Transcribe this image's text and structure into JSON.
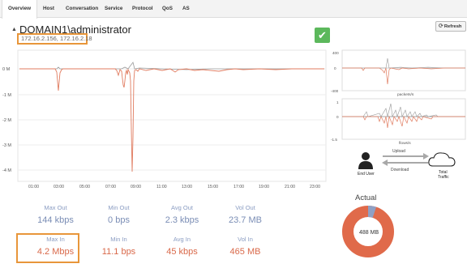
{
  "tabs": [
    {
      "label": "Overview",
      "active": true
    },
    {
      "label": "Host"
    },
    {
      "label": "Conversation"
    },
    {
      "label": "Service"
    },
    {
      "label": "Protocol"
    },
    {
      "label": "QoS"
    },
    {
      "label": "AS"
    }
  ],
  "refresh_label": "Refresh",
  "header": {
    "title": "DOMAIN1\\administrator",
    "ips": "172.16.2.156, 172.16.2.18"
  },
  "main_chart": {
    "y_ticks": [
      "0 M",
      "-1 M",
      "-2 M",
      "-3 M",
      "-4 M"
    ],
    "x_ticks": [
      "01:00",
      "03:00",
      "05:00",
      "07:00",
      "09:00",
      "11:00",
      "13:00",
      "15:00",
      "17:00",
      "19:00",
      "21:00",
      "23:00"
    ]
  },
  "chart_data": [
    {
      "type": "line",
      "x_labels": [
        "01:00",
        "03:00",
        "05:00",
        "07:00",
        "09:00",
        "11:00",
        "13:00",
        "15:00",
        "17:00",
        "19:00",
        "21:00",
        "23:00"
      ],
      "y_ticks": [
        "0 M",
        "-1 M",
        "-2 M",
        "-3 M",
        "-4 M"
      ],
      "series": [
        {
          "color": "#e07b5f",
          "values": [
            [
              2.8,
              -0.9
            ],
            [
              8.3,
              -0.6
            ],
            [
              8.6,
              -1.1
            ],
            [
              8.9,
              -4.2
            ],
            [
              9.3,
              -0.1
            ]
          ]
        },
        {
          "color": "#999999",
          "values": [
            [
              8.9,
              0.1
            ]
          ]
        }
      ]
    },
    {
      "type": "line",
      "y_ticks": [
        "400",
        "0",
        "-400"
      ],
      "xlabel": "packets/s"
    },
    {
      "type": "line",
      "y_ticks": [
        "1",
        "0",
        "-1.5"
      ],
      "xlabel": "flows/s"
    },
    {
      "type": "pie",
      "title": "Actual",
      "center_label": "488 MB",
      "slices": [
        {
          "color": "#e06a4a",
          "value": 465
        },
        {
          "color": "#8fa0c4",
          "value": 23.7
        }
      ]
    }
  ],
  "side": {
    "mini1": {
      "y_ticks": [
        "400",
        "0",
        "-400"
      ],
      "xlabel": "packets/s"
    },
    "mini2": {
      "y_ticks": [
        "1",
        "0",
        "-1.5"
      ],
      "xlabel": "flows/s"
    },
    "end_user": "End User",
    "total_traffic_line1": "Total",
    "total_traffic_line2": "Traffic",
    "upload": "Upload",
    "download": "Download"
  },
  "stats": {
    "out": [
      {
        "label": "Max Out",
        "value": "144 kbps"
      },
      {
        "label": "Min Out",
        "value": "0 bps"
      },
      {
        "label": "Avg Out",
        "value": "2.3 kbps"
      },
      {
        "label": "Vol Out",
        "value": "23.7 MB"
      }
    ],
    "in": [
      {
        "label": "Max In",
        "value": "4.2 Mbps"
      },
      {
        "label": "Min In",
        "value": "11.1 bps"
      },
      {
        "label": "Avg In",
        "value": "45 kbps"
      },
      {
        "label": "Vol In",
        "value": "465 MB"
      }
    ]
  },
  "donut": {
    "title": "Actual",
    "center_label": "488 MB"
  },
  "colors": {
    "accent_orange": "#e8963a",
    "in": "#e06a4a",
    "out": "#8fa0c4",
    "ok": "#5cb85c"
  }
}
